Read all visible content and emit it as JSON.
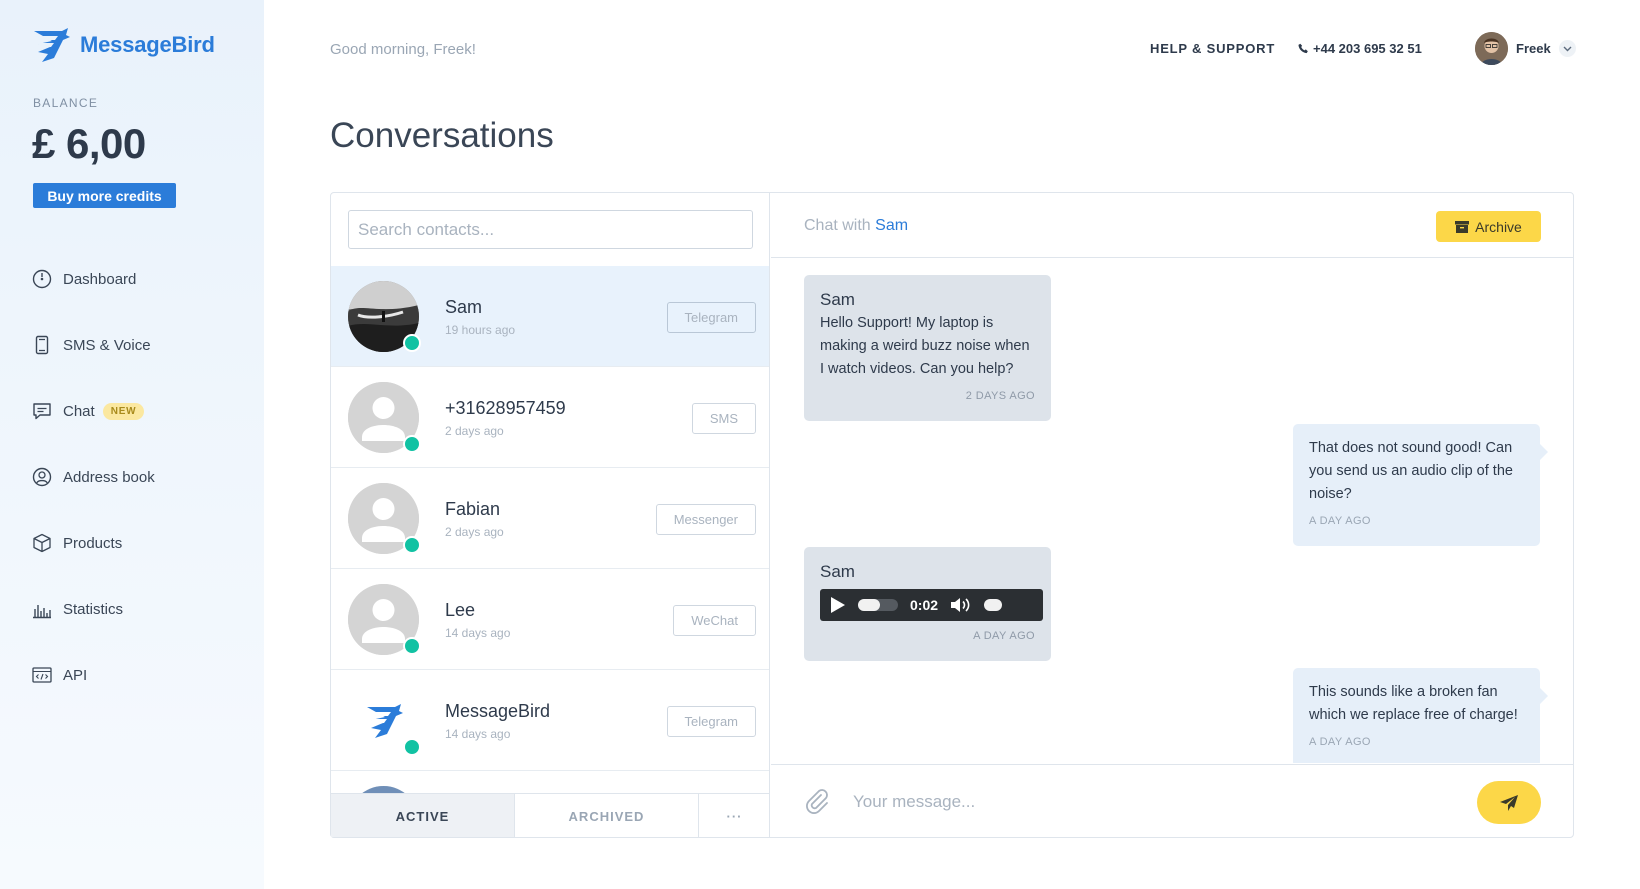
{
  "brand": {
    "name": "MessageBird",
    "accent": "#2b7cd9",
    "yellow": "#fcd748",
    "online": "#11c2a3"
  },
  "sidebar": {
    "balance_label": "BALANCE",
    "balance_value": "£ 6,00",
    "buy_label": "Buy more credits",
    "items": [
      {
        "label": "Dashboard",
        "icon": "dashboard-icon"
      },
      {
        "label": "SMS & Voice",
        "icon": "phone-device-icon"
      },
      {
        "label": "Chat",
        "icon": "chat-icon",
        "badge": "NEW"
      },
      {
        "label": "Address book",
        "icon": "contact-icon"
      },
      {
        "label": "Products",
        "icon": "box-icon"
      },
      {
        "label": "Statistics",
        "icon": "bar-chart-icon"
      },
      {
        "label": "API",
        "icon": "code-window-icon"
      }
    ]
  },
  "header": {
    "greeting": "Good morning, Freek!",
    "help": "HELP & SUPPORT",
    "phone": "+44 203 695 32 51",
    "user_name": "Freek"
  },
  "page_title": "Conversations",
  "contacts": {
    "search_placeholder": "Search contacts...",
    "items": [
      {
        "name": "Sam",
        "time": "19 hours ago",
        "channel": "Telegram"
      },
      {
        "name": "+31628957459",
        "time": "2 days ago",
        "channel": "SMS"
      },
      {
        "name": "Fabian",
        "time": "2 days ago",
        "channel": "Messenger"
      },
      {
        "name": "Lee",
        "time": "14 days ago",
        "channel": "WeChat"
      },
      {
        "name": "MessageBird",
        "time": "14 days ago",
        "channel": "Telegram"
      }
    ],
    "tabs": [
      "ACTIVE",
      "ARCHIVED",
      "···"
    ]
  },
  "chat": {
    "with_label": "Chat with",
    "with_name": "Sam",
    "archive_label": "Archive",
    "messages": [
      {
        "from": "Sam",
        "text": "Hello Support! My laptop is making a weird buzz noise when I watch videos. Can you help?",
        "time": "2 DAYS AGO"
      },
      {
        "text": "That does not sound good! Can you send us an audio clip of the noise?",
        "time": "A DAY AGO"
      },
      {
        "from": "Sam",
        "audio_time": "0:02",
        "audio_progress": 0.5,
        "time": "A DAY AGO"
      },
      {
        "text": "This sounds like a broken fan which we replace free of charge!",
        "time": "A DAY AGO"
      }
    ],
    "input_placeholder": "Your message..."
  }
}
